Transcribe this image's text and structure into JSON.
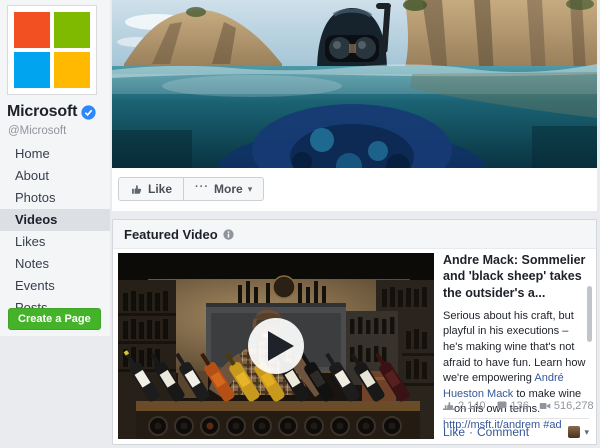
{
  "colors": {
    "ms_red": "#f25022",
    "ms_green": "#7fba00",
    "ms_blue": "#00a4ef",
    "ms_yellow": "#ffb900",
    "verified_blue": "#2d88ff",
    "link_blue": "#365899",
    "create_green": "#45b32a"
  },
  "sidebar": {
    "page_name": "Microsoft",
    "handle": "@Microsoft",
    "nav": [
      {
        "label": "Home"
      },
      {
        "label": "About"
      },
      {
        "label": "Photos"
      },
      {
        "label": "Videos"
      },
      {
        "label": "Likes"
      },
      {
        "label": "Notes"
      },
      {
        "label": "Events"
      },
      {
        "label": "Posts"
      }
    ],
    "create_page_label": "Create a Page"
  },
  "action_bar": {
    "like_label": "Like",
    "more_dots": "···",
    "more_label": "More",
    "more_caret": "▾"
  },
  "featured": {
    "section_title": "Featured Video",
    "video_title": "Andre Mack: Sommelier and 'black sheep' takes the outsider's a...",
    "desc_text_1": "Serious about his craft, but playful in his executions – he's making wine that's not afraid to have fun. Learn how we're empowering ",
    "desc_link_1": "André Hueston Mack",
    "desc_text_2": " to make wine—on his own terms. ",
    "desc_link_2": "http://msft.it/andrem",
    "desc_text_3": " ",
    "desc_link_3": "#ad",
    "stats": {
      "likes": "2,140",
      "comments": "136",
      "views": "516,278"
    },
    "actions": {
      "like": "Like",
      "separator": "·",
      "comment": "Comment"
    }
  }
}
